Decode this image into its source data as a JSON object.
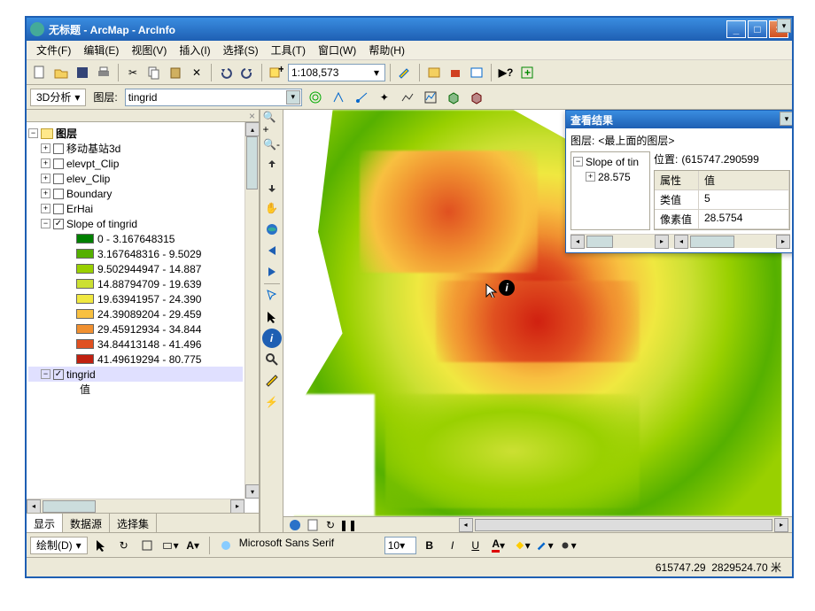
{
  "title": "无标题 - ArcMap - ArcInfo",
  "menus": [
    "文件(F)",
    "编辑(E)",
    "视图(V)",
    "插入(I)",
    "选择(S)",
    "工具(T)",
    "窗口(W)",
    "帮助(H)"
  ],
  "scale": "1:108,573",
  "toolbar2": {
    "analysisLabel": "3D分析",
    "layerLabel": "图层:",
    "layerValue": "tingrid"
  },
  "toc": {
    "root": "图层",
    "layers": [
      {
        "name": "移动基站3d",
        "checked": false
      },
      {
        "name": "elevpt_Clip",
        "checked": false
      },
      {
        "name": "elev_Clip",
        "checked": false
      },
      {
        "name": "Boundary",
        "checked": false
      },
      {
        "name": "ErHai",
        "checked": false
      }
    ],
    "slope": {
      "name": "Slope of tingrid",
      "checked": true,
      "classes": [
        {
          "c": "#008000",
          "l": "0 - 3.167648315"
        },
        {
          "c": "#55b000",
          "l": "3.167648316 - 9.5029"
        },
        {
          "c": "#99d000",
          "l": "9.502944947 - 14.887"
        },
        {
          "c": "#cce033",
          "l": "14.88794709 - 19.639"
        },
        {
          "c": "#f0e840",
          "l": "19.63941957 - 24.390"
        },
        {
          "c": "#f8c040",
          "l": "24.39089204 - 29.459"
        },
        {
          "c": "#f09030",
          "l": "29.45912934 - 34.844"
        },
        {
          "c": "#e05020",
          "l": "34.84413148 - 41.496"
        },
        {
          "c": "#c02010",
          "l": "41.49619294 - 80.775"
        }
      ]
    },
    "tingrid": {
      "name": "tingrid",
      "checked": true,
      "sub": "值"
    }
  },
  "tocTabs": [
    "显示",
    "数据源",
    "选择集"
  ],
  "results": {
    "title": "查看结果",
    "layerLabel": "图层:",
    "layerValue": "<最上面的图层>",
    "treeItem": "Slope of tin",
    "treeSub": "28.575",
    "posLabel": "位置:",
    "posValue": "(615747.290599",
    "headers": [
      "属性",
      "值"
    ],
    "rows": [
      [
        "类值",
        "5"
      ],
      [
        "像素值",
        "28.5754"
      ]
    ]
  },
  "drawbar": {
    "label": "绘制(D)",
    "font": "Microsoft Sans Serif",
    "size": "10"
  },
  "status": "615747.29  2829524.70 米"
}
